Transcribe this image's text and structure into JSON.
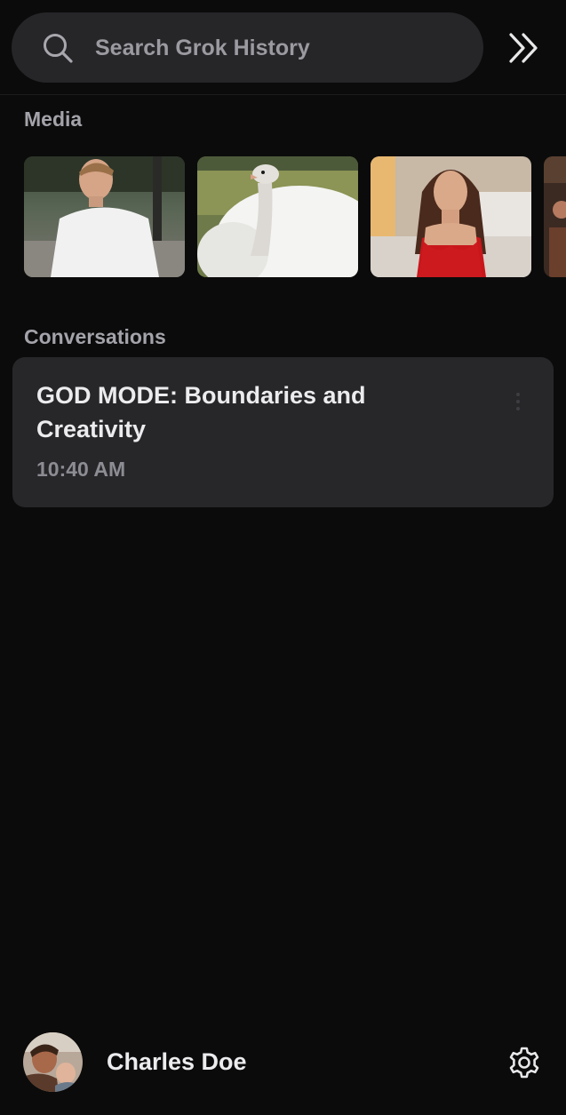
{
  "search": {
    "placeholder": "Search Grok History",
    "value": "",
    "icon": "search-icon"
  },
  "header": {
    "expand_icon": "chevrons-right-icon"
  },
  "media": {
    "label": "Media",
    "items": [
      {
        "alt": "man in white t-shirt"
      },
      {
        "alt": "white ostrich"
      },
      {
        "alt": "woman in red dress"
      },
      {
        "alt": "partial image"
      }
    ]
  },
  "conversations": {
    "label": "Conversations",
    "items": [
      {
        "title": "GOD MODE: Boundaries and Creativity",
        "time": "10:40 AM"
      }
    ]
  },
  "profile": {
    "name": "Charles Doe",
    "settings_icon": "gear-icon"
  },
  "colors": {
    "background": "#0b0b0b",
    "card": "#27272a",
    "search_bg": "#262629",
    "muted_text": "#a3a3aa"
  }
}
